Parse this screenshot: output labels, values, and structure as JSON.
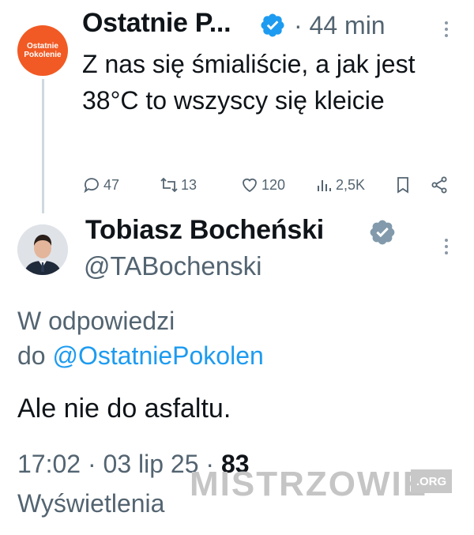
{
  "tweet1": {
    "avatar_text_line1": "Ostatnie",
    "avatar_text_line2": "Pokolenie",
    "display_name": "Ostatnie P...",
    "time": "· 44 min",
    "text": "Z nas się śmialiście, a jak jest 38°C to wszyscy się kleicie",
    "replies": "47",
    "reposts": "13",
    "likes": "120",
    "views": "2,5K",
    "icons": [
      "reply-icon",
      "repost-icon",
      "like-icon",
      "views-icon",
      "bookmark-icon",
      "share-icon",
      "more-icon",
      "verified-icon"
    ]
  },
  "tweet2": {
    "display_name": "Tobiasz Bocheński",
    "handle": "@TABochenski",
    "reply_prefix": "W odpowiedzi",
    "reply_to_word": "do",
    "reply_to_handle": "@OstatniePokolen",
    "text": "Ale nie do asfaltu.",
    "timestamp": "17:02 · 03 lip 25 ·",
    "views_count": "83",
    "views_label": "Wyświetlenia"
  },
  "watermark": {
    "text": "MISTRZOWIE",
    "suffix": ".ORG"
  },
  "colors": {
    "accent": "#1d9bf0",
    "secondary_text": "#536471",
    "avatar_orange": "#f15a24"
  }
}
